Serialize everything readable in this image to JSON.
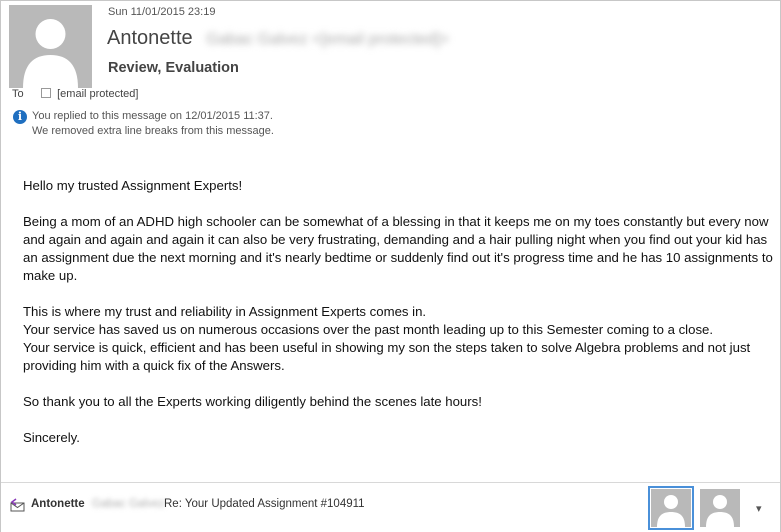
{
  "header": {
    "date": "Sun 11/01/2015 23:19",
    "sender_name": "Antonette",
    "sender_email_redacted": "Gabac Galvez <[email protected]>",
    "subject": "Review, Evaluation",
    "to_label": "To",
    "to_address": "[email protected]",
    "info_lines": [
      "You replied to this message on 12/01/2015 11:37.",
      "We removed extra line breaks from this message."
    ]
  },
  "body": {
    "greeting": "Hello my trusted Assignment Experts!",
    "paragraph1": "Being a mom of an ADHD high schooler can be somewhat of a blessing in that it keeps me on my toes constantly but every now and again and again and again it can also be very frustrating, demanding and a hair pulling night when you find out your kid has an assignment due the next morning and it's nearly bedtime or suddenly find out it's progress time and he has 10 assignments to make up.",
    "paragraph2_line1": "This is where my trust and reliability in Assignment Experts comes in.",
    "paragraph2_line2": "Your service has saved us on numerous occasions over the past month leading up to this Semester coming to a close.",
    "paragraph2_line3": "Your service is quick, efficient and has been useful in showing my son the steps taken to solve Algebra problems and not just providing him with a quick fix of the Answers.",
    "paragraph3": "So thank you to all the Experts working diligently behind the scenes late hours!",
    "closing": "Sincerely."
  },
  "bottom_bar": {
    "name": "Antonette",
    "name_redacted": "Gabac Galvez",
    "subject": "Re: Your  Updated Assignment #104911",
    "chevron": "▾"
  },
  "icons": {
    "avatar": "person-silhouette-icon",
    "info": "info-icon",
    "reply": "reply-envelope-icon"
  }
}
